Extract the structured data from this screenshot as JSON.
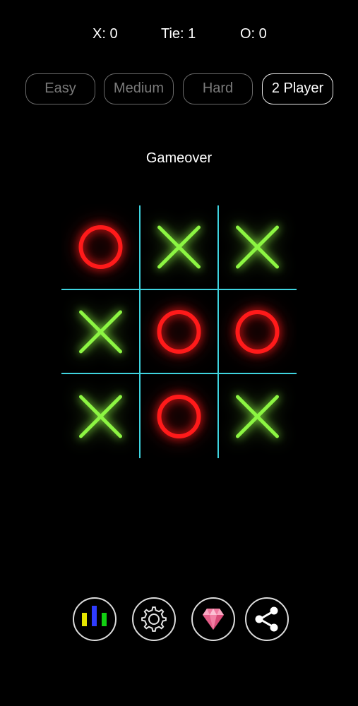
{
  "scoreboard": {
    "x_score": "X: 0",
    "tie_score": "Tie: 1",
    "o_score": "O: 0"
  },
  "modes": [
    {
      "label": "Easy",
      "active": false
    },
    {
      "label": "Medium",
      "active": false
    },
    {
      "label": "Hard",
      "active": false
    },
    {
      "label": "2 Player",
      "active": true
    }
  ],
  "status": "Gameover",
  "board": {
    "cells": [
      "O",
      "X",
      "X",
      "X",
      "O",
      "O",
      "X",
      "O",
      "X"
    ],
    "x_color": "#8cf542",
    "o_color": "#ff1a1a",
    "grid_color": "#3fd4e0"
  },
  "toolbar": {
    "icons": [
      "leaderboard-icon",
      "settings-gear-icon",
      "gem-icon",
      "share-icon"
    ]
  }
}
